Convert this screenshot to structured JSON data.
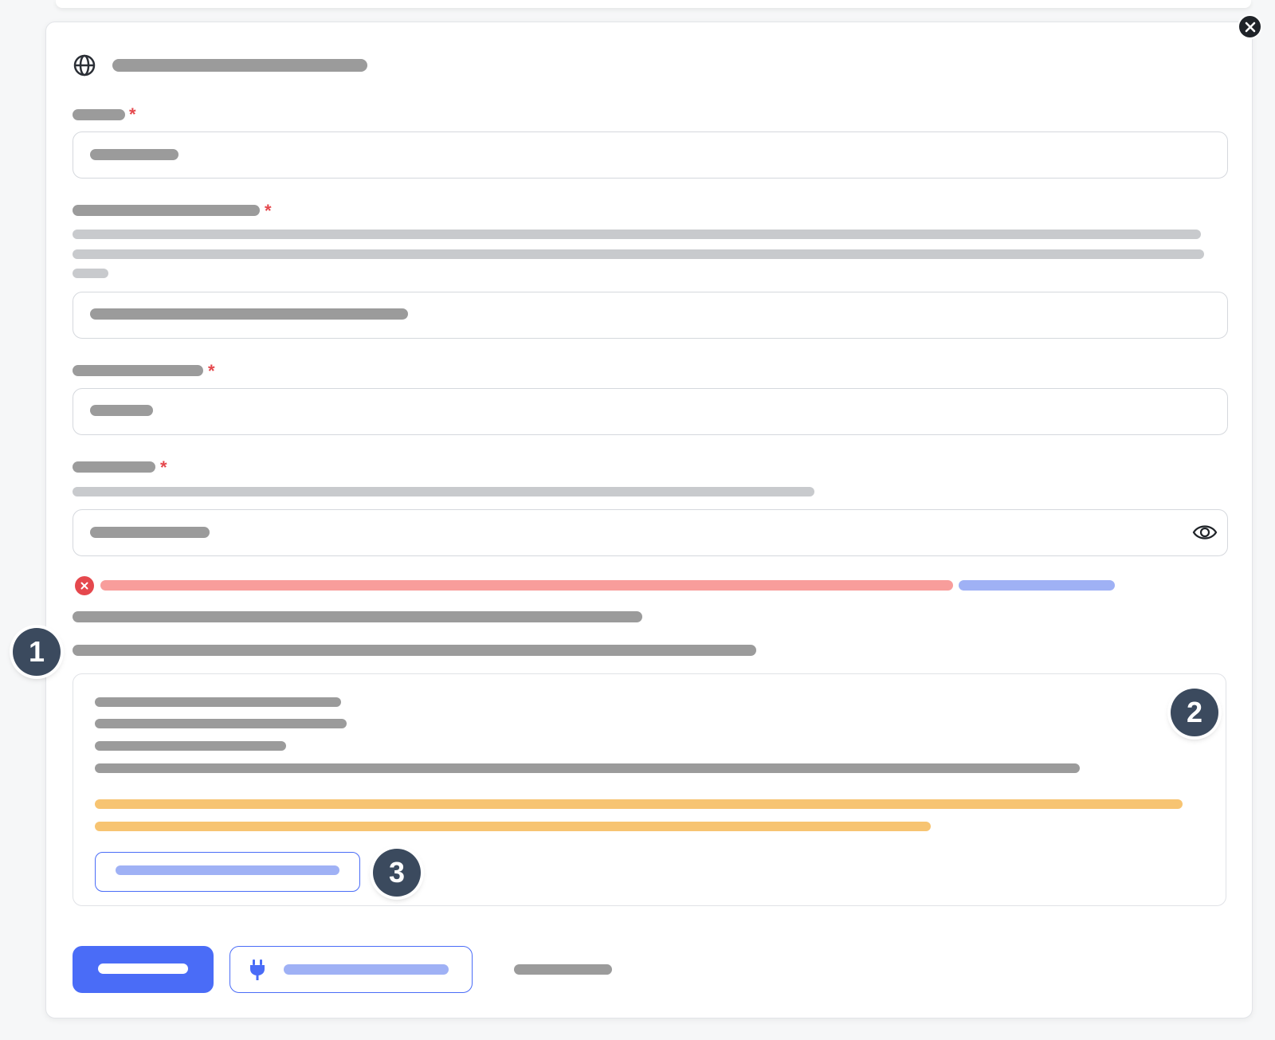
{
  "dialog": {
    "title_icon": "globe-icon",
    "close_icon": "close-icon"
  },
  "form": {
    "required_marker": "*",
    "password_toggle_icon": "eye-icon",
    "error_icon": "error-x-icon"
  },
  "badges": {
    "first": "1",
    "second": "2",
    "third": "3"
  },
  "actions": {
    "secondary_icon": "plug-icon"
  },
  "colors": {
    "primary": "#4a6cf7",
    "error": "#e5484d",
    "warning": "#f7c472",
    "badge": "#3b4a5e"
  }
}
